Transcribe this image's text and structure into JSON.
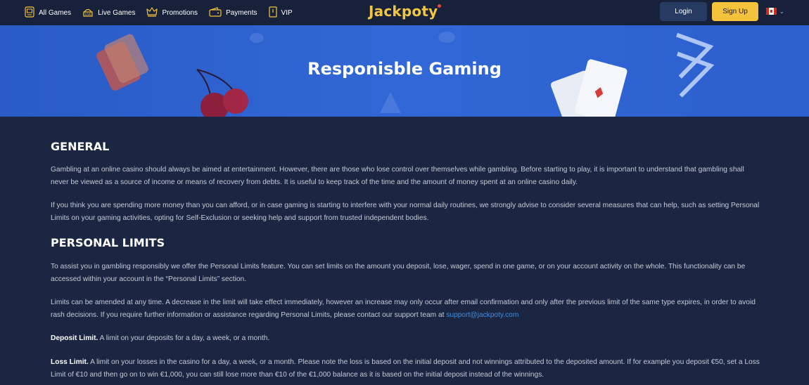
{
  "nav": {
    "items": [
      {
        "label": "All Games",
        "icon": "slot-machine-icon"
      },
      {
        "label": "Live Games",
        "icon": "live-dealer-icon"
      },
      {
        "label": "Promotions",
        "icon": "crown-icon"
      },
      {
        "label": "Payments",
        "icon": "wallet-icon"
      },
      {
        "label": "VIP",
        "icon": "vip-card-icon"
      }
    ]
  },
  "brand": {
    "logo_text": "Jackpoty",
    "accent": "#f5c33b"
  },
  "auth": {
    "login_label": "Login",
    "signup_label": "Sign Up"
  },
  "language": {
    "flag": "canada-flag-icon"
  },
  "hero": {
    "title": "Responisble Gaming"
  },
  "sections": {
    "general": {
      "heading": "GENERAL",
      "p1": "Gambling at an online casino should always be aimed at entertainment. However, there are those who lose control over themselves while gambling. Before starting to play, it is important to understand that gambling shall never be viewed as a source of income or means of recovery from debts. It is useful to keep track of the time and the amount of money spent at an online casino daily.",
      "p2": "If you think you are spending more money than you can afford, or in case gaming is starting to interfere with your normal daily routines, we strongly advise to consider several measures that can help, such as setting Personal Limits on your gaming activities, opting for Self-Exclusion or seeking help and support from trusted independent bodies."
    },
    "limits": {
      "heading": "PERSONAL LIMITS",
      "p1": "To assist you in gambling responsibly we offer the Personal Limits feature. You can set limits on the amount you deposit, lose, wager, spend in one game, or on your account activity on the whole. This functionality can be accessed within your account in the “Personal Limits” section.",
      "p2": "Limits can be amended at any time. A decrease in the limit will take effect immediately, however an increase may only occur after email confirmation and only after the previous limit of the same type expires, in order to avoid rash decisions. If you require further information or assistance regarding Personal Limits, please contact our support team at",
      "support_email": "support@jackpoty.com",
      "deposit_title": "Deposit Limit.",
      "deposit_text": "A limit on your deposits for a day, a week, or a month.",
      "loss_title": "Loss Limit.",
      "loss_text": "A limit on your losses in the casino for a day, a week, or a month. Please note the loss is based on the initial deposit and not winnings attributed to the deposited amount. If for example you deposit €50, set a Loss Limit of €10 and then go on to win €1,000, you can still lose more than €10 of the €1,000 balance as it is based on the initial deposit instead of the winnings."
    }
  }
}
